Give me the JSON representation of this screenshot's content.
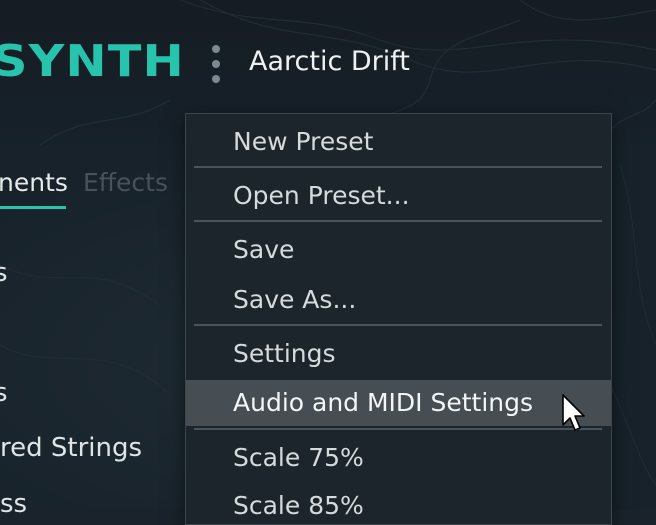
{
  "header": {
    "logo_text": "SYNTH",
    "preset_name": "Aarctic Drift",
    "menu_icon": "kebab-vertical-icon"
  },
  "tabs": [
    {
      "label": "nents",
      "active": true
    },
    {
      "label": "Effects",
      "active": false
    }
  ],
  "background_list": [
    "s",
    "s",
    "red Strings",
    "ss"
  ],
  "dropdown_menu": {
    "items": [
      {
        "label": "New Preset"
      },
      {
        "label": "Open Preset..."
      },
      {
        "label": "Save"
      },
      {
        "label": "Save As..."
      },
      {
        "label": "Settings"
      },
      {
        "label": "Audio and MIDI Settings",
        "hovered": true
      },
      {
        "label": "Scale 75%"
      },
      {
        "label": "Scale 85%"
      }
    ]
  },
  "colors": {
    "accent": "#27c3ad",
    "background": "#1a232b",
    "menu_background": "#1d252c",
    "menu_hover": "#464e53"
  },
  "cursor": "arrow-pointer-icon"
}
